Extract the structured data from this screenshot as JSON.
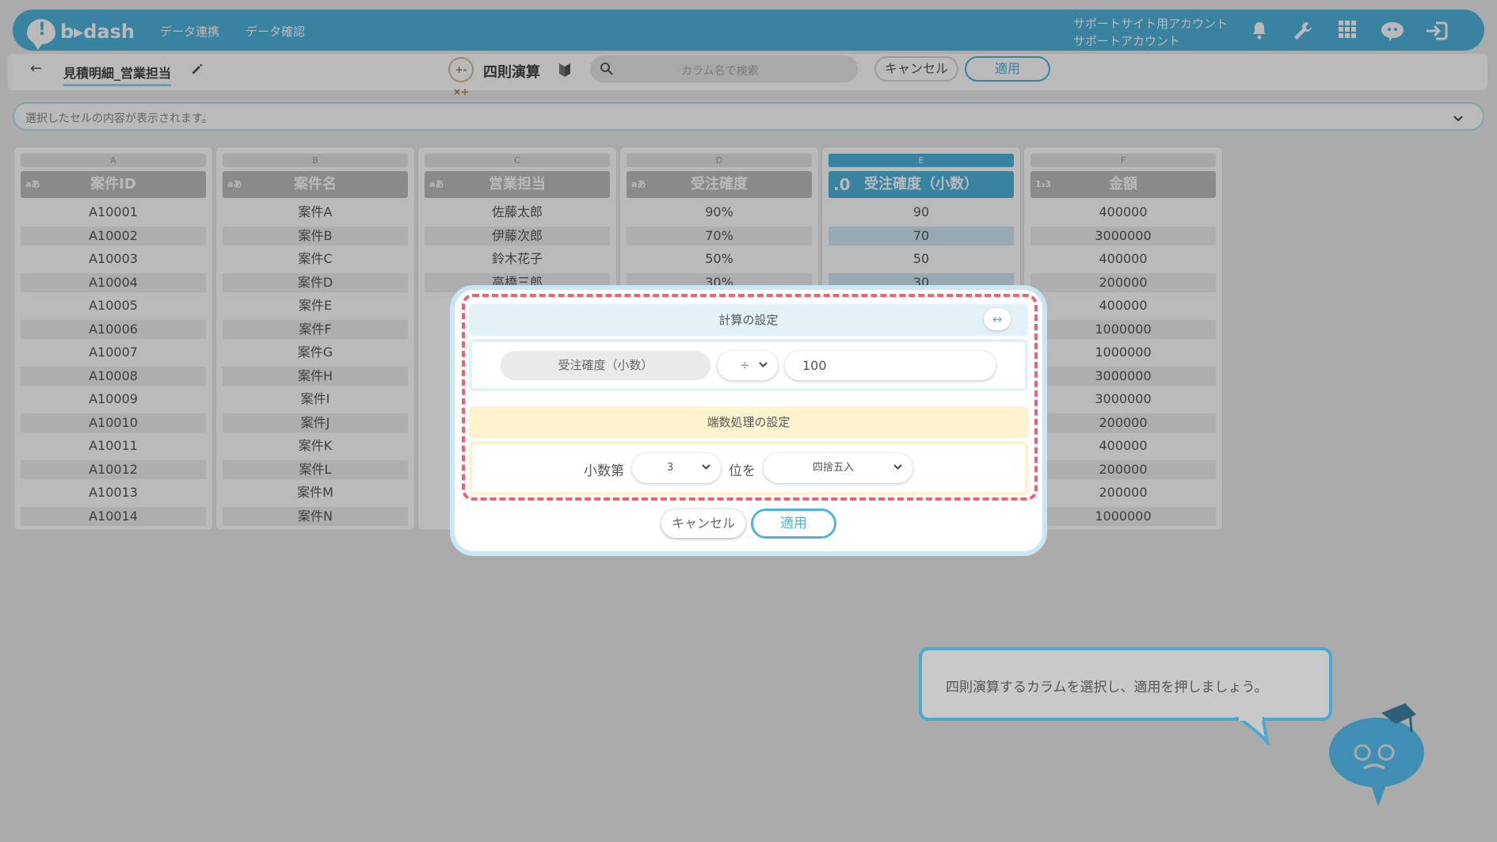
{
  "header": {
    "logo_text": "b▸dash",
    "nav": [
      "データ連携",
      "データ確認"
    ],
    "account_line1": "サポートサイト用アカウント",
    "account_line2": "サポートアカウント",
    "icons": [
      "bell-icon",
      "wrench-icon",
      "apps-grid-icon",
      "brain-icon",
      "logout-icon"
    ]
  },
  "toolbar": {
    "back": "←",
    "file_name": "見積明細_営業担当",
    "calc_icon": "+-×÷",
    "calc_title": "四則演算",
    "search_placeholder": "カラム名で検索",
    "cancel": "キャンセル",
    "apply": "適用"
  },
  "cell_bar": {
    "placeholder": "選択したセルの内容が表示されます。"
  },
  "grid": {
    "columns": [
      {
        "letter": "A",
        "type": "aあ",
        "header": "案件ID",
        "cells": [
          "A10001",
          "A10002",
          "A10003",
          "A10004",
          "A10005",
          "A10006",
          "A10007",
          "A10008",
          "A10009",
          "A10010",
          "A10011",
          "A10012",
          "A10013",
          "A10014"
        ]
      },
      {
        "letter": "B",
        "type": "aあ",
        "header": "案件名",
        "cells": [
          "案件A",
          "案件B",
          "案件C",
          "案件D",
          "案件E",
          "案件F",
          "案件G",
          "案件H",
          "案件I",
          "案件J",
          "案件K",
          "案件L",
          "案件M",
          "案件N"
        ]
      },
      {
        "letter": "C",
        "type": "aあ",
        "header": "営業担当",
        "cells": [
          "佐藤太郎",
          "伊藤次郎",
          "鈴木花子",
          "高橋三郎"
        ]
      },
      {
        "letter": "D",
        "type": "aあ",
        "header": "受注確度",
        "cells": [
          "90%",
          "70%",
          "50%",
          "30%"
        ]
      },
      {
        "letter": "E",
        "type": ".0",
        "header": "受注確度（小数）",
        "cells": [
          "90",
          "70",
          "50",
          "30"
        ]
      },
      {
        "letter": "F",
        "type": "1₂3",
        "header": "金額",
        "cells": [
          "400000",
          "3000000",
          "400000",
          "200000",
          "400000",
          "1000000",
          "1000000",
          "3000000",
          "3000000",
          "200000",
          "400000",
          "200000",
          "200000",
          "1000000"
        ]
      }
    ]
  },
  "modal": {
    "calc_section_title": "計算の設定",
    "swap_icon": "↔",
    "source_column": "受注確度（小数）",
    "operator": "÷",
    "operand": "100",
    "rounding_section_title": "端数処理の設定",
    "decimal_label_before": "小数第",
    "decimal_places": "3",
    "decimal_label_after": "位を",
    "rounding_method": "四捨五入",
    "cancel": "キャンセル",
    "apply": "適用"
  },
  "hint": {
    "text": "四則演算するカラムを選択し、適用を押しましょう。"
  },
  "colors": {
    "accent": "#4fb2dc",
    "highlight_dash": "#ef6070",
    "calc_section_bg": "#e3f1f9",
    "rounding_section_bg": "#fff3cf"
  }
}
